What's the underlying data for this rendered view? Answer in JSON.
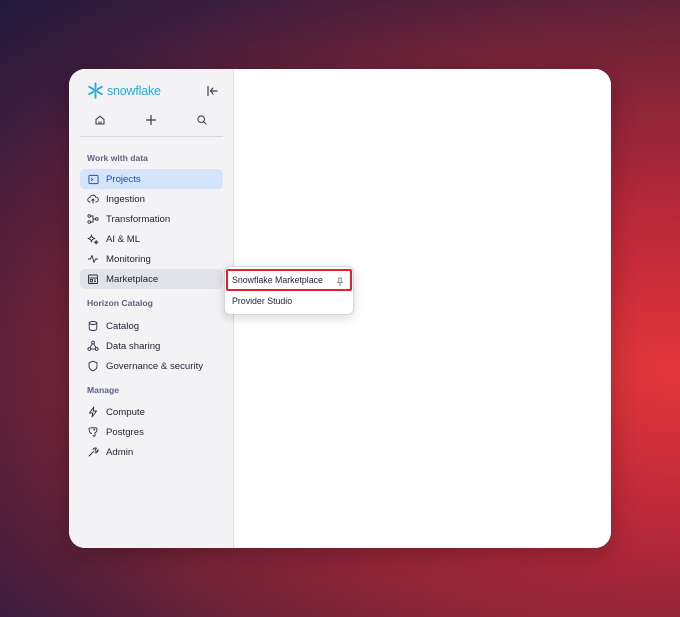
{
  "brand": {
    "name": "snowflake",
    "icon": "snowflake-logo"
  },
  "toolbar": {
    "collapse_icon": "collapse-sidebar-icon",
    "actions": [
      {
        "name": "home",
        "icon": "home-icon"
      },
      {
        "name": "create",
        "icon": "plus-icon"
      },
      {
        "name": "search",
        "icon": "search-icon"
      }
    ]
  },
  "sidebar": {
    "sections": [
      {
        "title": "Work with data",
        "items": [
          {
            "label": "Projects",
            "icon": "projects-icon",
            "active": true
          },
          {
            "label": "Ingestion",
            "icon": "cloud-upload-icon"
          },
          {
            "label": "Transformation",
            "icon": "transformation-icon"
          },
          {
            "label": "AI & ML",
            "icon": "sparkle-icon"
          },
          {
            "label": "Monitoring",
            "icon": "activity-icon"
          },
          {
            "label": "Marketplace",
            "icon": "marketplace-icon",
            "hovered": true
          }
        ]
      },
      {
        "title": "Horizon Catalog",
        "items": [
          {
            "label": "Catalog",
            "icon": "database-icon"
          },
          {
            "label": "Data sharing",
            "icon": "share-icon"
          },
          {
            "label": "Governance & security",
            "icon": "shield-icon"
          }
        ]
      },
      {
        "title": "Manage",
        "items": [
          {
            "label": "Compute",
            "icon": "bolt-icon"
          },
          {
            "label": "Postgres",
            "icon": "postgres-icon"
          },
          {
            "label": "Admin",
            "icon": "admin-icon"
          }
        ]
      }
    ]
  },
  "submenu": {
    "items": [
      {
        "label": "Snowflake Marketplace",
        "icon": "pin-icon",
        "highlighted": true
      },
      {
        "label": "Provider Studio"
      }
    ]
  },
  "colors": {
    "accent": "#29a9dc",
    "active_bg": "#d4e4fb",
    "highlight": "#e1212b"
  }
}
